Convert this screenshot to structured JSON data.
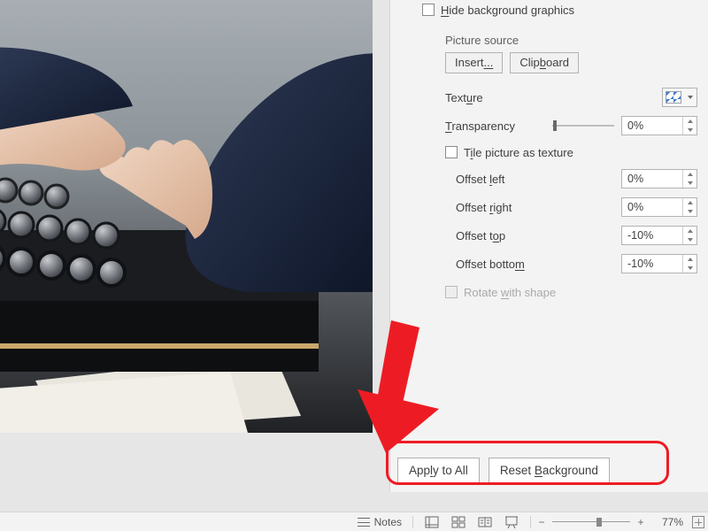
{
  "pane": {
    "hide_bg_label_pre": "H",
    "hide_bg_label_post": "ide background graphics",
    "picture_source_title": "Picture source",
    "insert_btn_part1": "Insert",
    "insert_btn_part2": "...",
    "clipboard_btn_pre": "Clip",
    "clipboard_btn_underlined": "b",
    "clipboard_btn_post": "oard",
    "texture_label_pre": "Text",
    "texture_label_underlined": "u",
    "texture_label_post": "re",
    "transparency_label_underlined": "T",
    "transparency_label_post": "ransparency",
    "transparency_value": "0%",
    "tile_label_pre": "T",
    "tile_label_underlined": "i",
    "tile_label_post": "le picture as texture",
    "offset_left_pre": "Offset ",
    "offset_left_underlined": "l",
    "offset_left_post": "eft",
    "offset_left_value": "0%",
    "offset_right_pre": "Offset ",
    "offset_right_underlined": "r",
    "offset_right_post": "ight",
    "offset_right_value": "0%",
    "offset_top_pre": "Offset t",
    "offset_top_underlined": "o",
    "offset_top_post": "p",
    "offset_top_value": "-10%",
    "offset_bottom_pre": "Offset botto",
    "offset_bottom_underlined": "m",
    "offset_bottom_post": "",
    "offset_bottom_value": "-10%",
    "rotate_label_pre": "Rotate ",
    "rotate_label_underlined": "w",
    "rotate_label_post": "ith shape",
    "apply_label_pre": "App",
    "apply_label_underlined": "l",
    "apply_label_post": "y to All",
    "reset_label_pre": "Reset ",
    "reset_label_underlined": "B",
    "reset_label_post": "ackground"
  },
  "footer": {
    "notes_label": "Notes",
    "zoom_percent": "77%"
  }
}
